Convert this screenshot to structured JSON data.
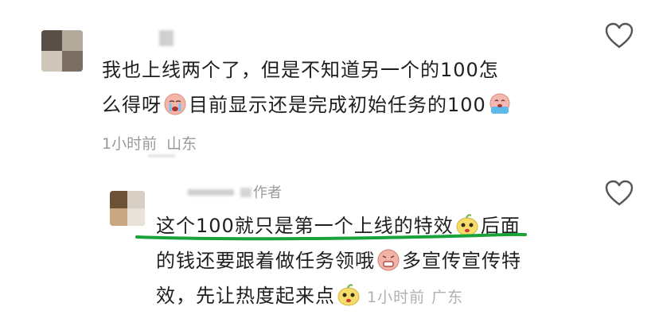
{
  "comment1": {
    "line1": "我也上线两个了，但是不知道另一个的100怎",
    "line2a": "么得呀",
    "line2b": "目前显示还是完成初始任务的100",
    "time": "1小时前",
    "location": "山东",
    "emoji1": "crying-emoji",
    "emoji2": "sobbing-emoji"
  },
  "reply": {
    "author_tag": "作者",
    "line1a": "这个100就只是第一个上线的特效",
    "line1b": "后面",
    "line2a": "的钱还要跟着做任务领哦",
    "line2b": "多宣传宣传特",
    "line3": "效，先让热度起来点",
    "time": "1小时前",
    "location": "广东",
    "emoji1": "cute-emoji",
    "emoji2": "grimace-emoji",
    "emoji3": "cute-emoji"
  },
  "colors": {
    "underline": "#1aa23a",
    "meta": "#9a9a9a"
  }
}
